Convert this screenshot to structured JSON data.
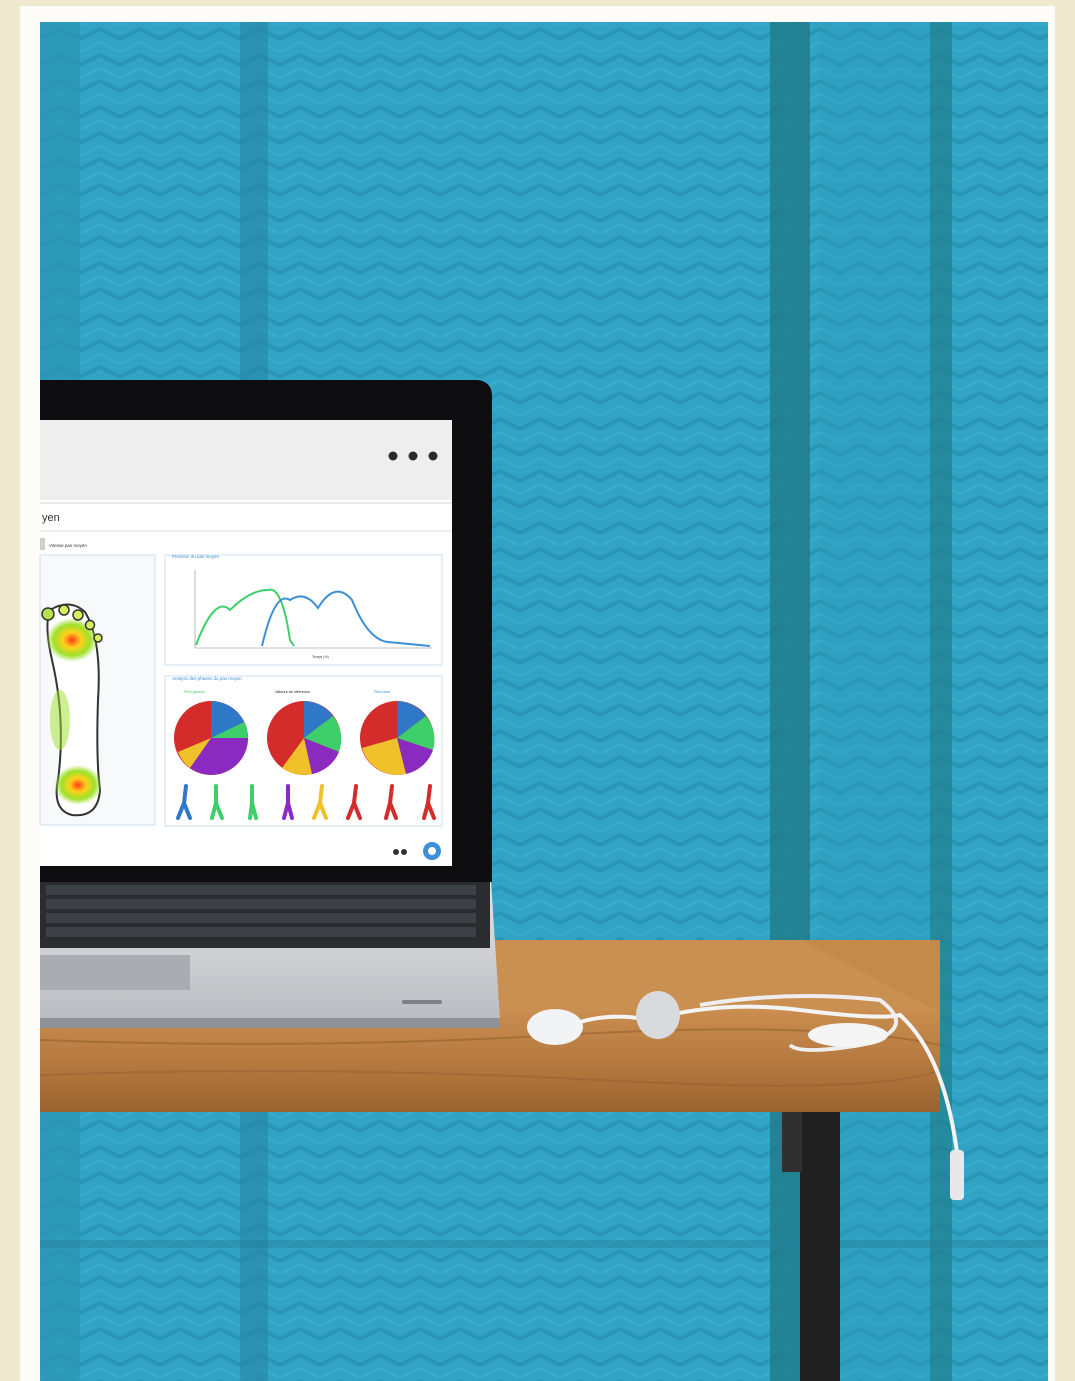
{
  "screen": {
    "title_fragment": "yen",
    "tab_label": "Vitesse pas moyen",
    "line_panel": {
      "title": "Pression du pas moyen",
      "xlabel": "Temps (%)"
    },
    "pie_panel": {
      "title": "Analyse des phases du pas moyen",
      "labels": [
        "Pied gauche",
        "Valeurs de référence",
        "Pied droit"
      ]
    }
  },
  "colors": {
    "wall": "#2e9fc0",
    "frame": "#fdfcf8",
    "accent_blue": "#3c8fd8",
    "green": "#3ecf6a"
  },
  "icons": [
    "window-dots-icon",
    "chat-bubble-icon",
    "foot-heatmap-icon",
    "gait-figure-icon"
  ]
}
